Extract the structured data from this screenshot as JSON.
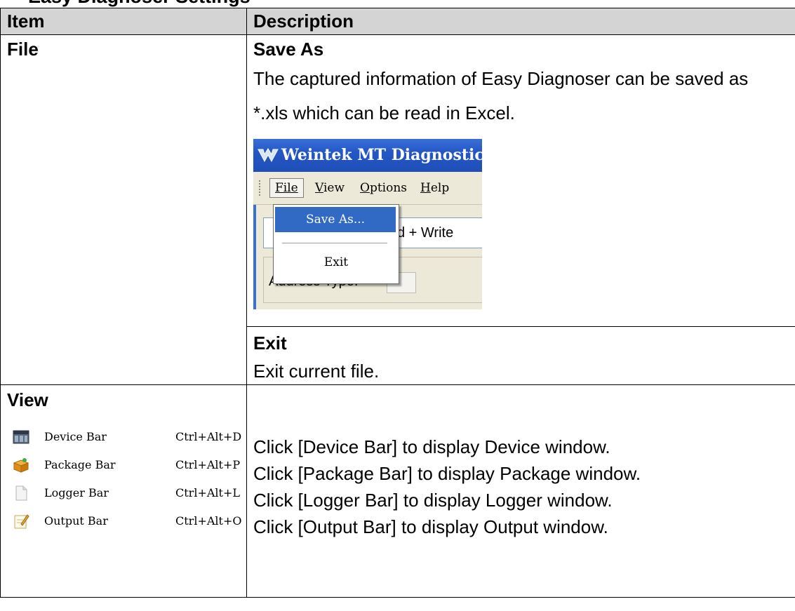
{
  "section_title": "Easy Diagnoser Settings",
  "table": {
    "headers": [
      "Item",
      "Description"
    ],
    "file_row": {
      "item": "File",
      "save_as": {
        "heading": "Save As",
        "text": "The captured information of Easy Diagnoser can be saved as *.xls which can be read in Excel."
      },
      "screenshot": {
        "window_title": "Weintek MT Diagnostic",
        "menus": [
          "File",
          "View",
          "Options",
          "Help"
        ],
        "menu_items": [
          "Save As...",
          "Exit"
        ],
        "combo_value": "d + Write",
        "address_label": "Address Type:"
      },
      "exit": {
        "heading": "Exit",
        "text": "Exit current file."
      }
    },
    "view_row": {
      "item": "View",
      "menu_items": [
        {
          "name": "Device Bar",
          "shortcut": "Ctrl+Alt+D",
          "icon": "device-bar-icon"
        },
        {
          "name": "Package Bar",
          "shortcut": "Ctrl+Alt+P",
          "icon": "package-bar-icon"
        },
        {
          "name": "Logger Bar",
          "shortcut": "Ctrl+Alt+L",
          "icon": "logger-bar-icon"
        },
        {
          "name": "Output Bar",
          "shortcut": "Ctrl+Alt+O",
          "icon": "output-bar-icon"
        }
      ],
      "descriptions": [
        "Click [Device Bar] to display Device window.",
        "Click [Package Bar] to display Package window.",
        "Click [Logger Bar] to display Logger window.",
        "Click [Output Bar] to display Output window."
      ]
    }
  },
  "colors": {
    "header_bg": "#d4d4d4",
    "xp_title_blue": "#2457c5",
    "menu_highlight": "#316ac5",
    "xp_face": "#ece9d8"
  }
}
